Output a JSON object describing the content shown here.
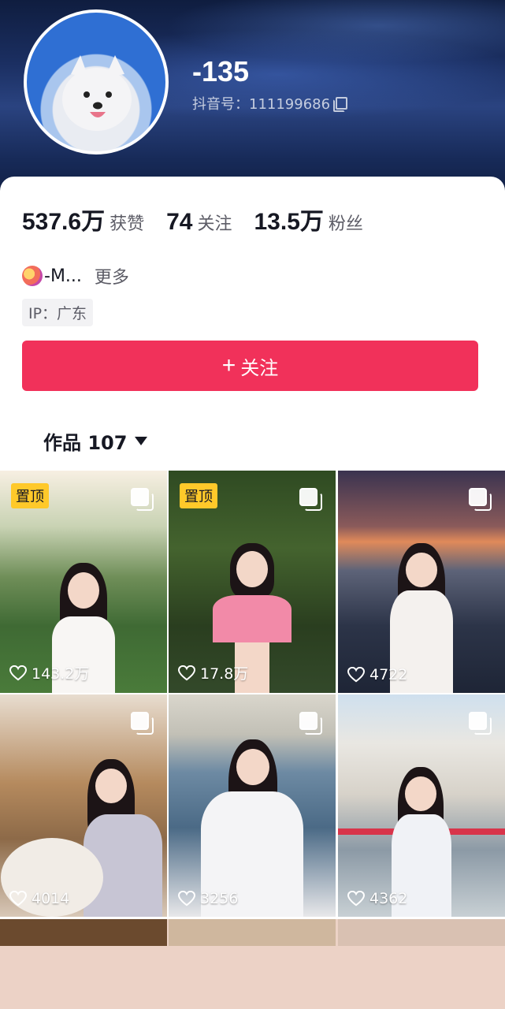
{
  "profile": {
    "name": "-135",
    "douyin_id": "抖音号：111199686",
    "stats": [
      {
        "value": "537.6万",
        "label": "获赞"
      },
      {
        "value": "74",
        "label": "关注"
      },
      {
        "value": "13.5万",
        "label": "粉丝"
      }
    ],
    "bio": "-M...",
    "bio_more": "更多",
    "ip": "IP：广东",
    "follow_label": "关注",
    "works_label": "作品 107"
  },
  "grid": [
    {
      "likes": "143.2万",
      "pinned": "置顶",
      "icon": "multi-image-icon"
    },
    {
      "likes": "17.8万",
      "pinned": "置顶",
      "icon": "multi-image-icon"
    },
    {
      "likes": "4722",
      "icon": "multi-image-icon"
    },
    {
      "likes": "4014",
      "icon": "multi-image-icon"
    },
    {
      "likes": "3256",
      "icon": "multi-image-icon"
    },
    {
      "likes": "4362",
      "icon": "multi-image-icon"
    }
  ],
  "colors": {
    "accent": "#f1315a",
    "pin": "#ffc92a"
  }
}
